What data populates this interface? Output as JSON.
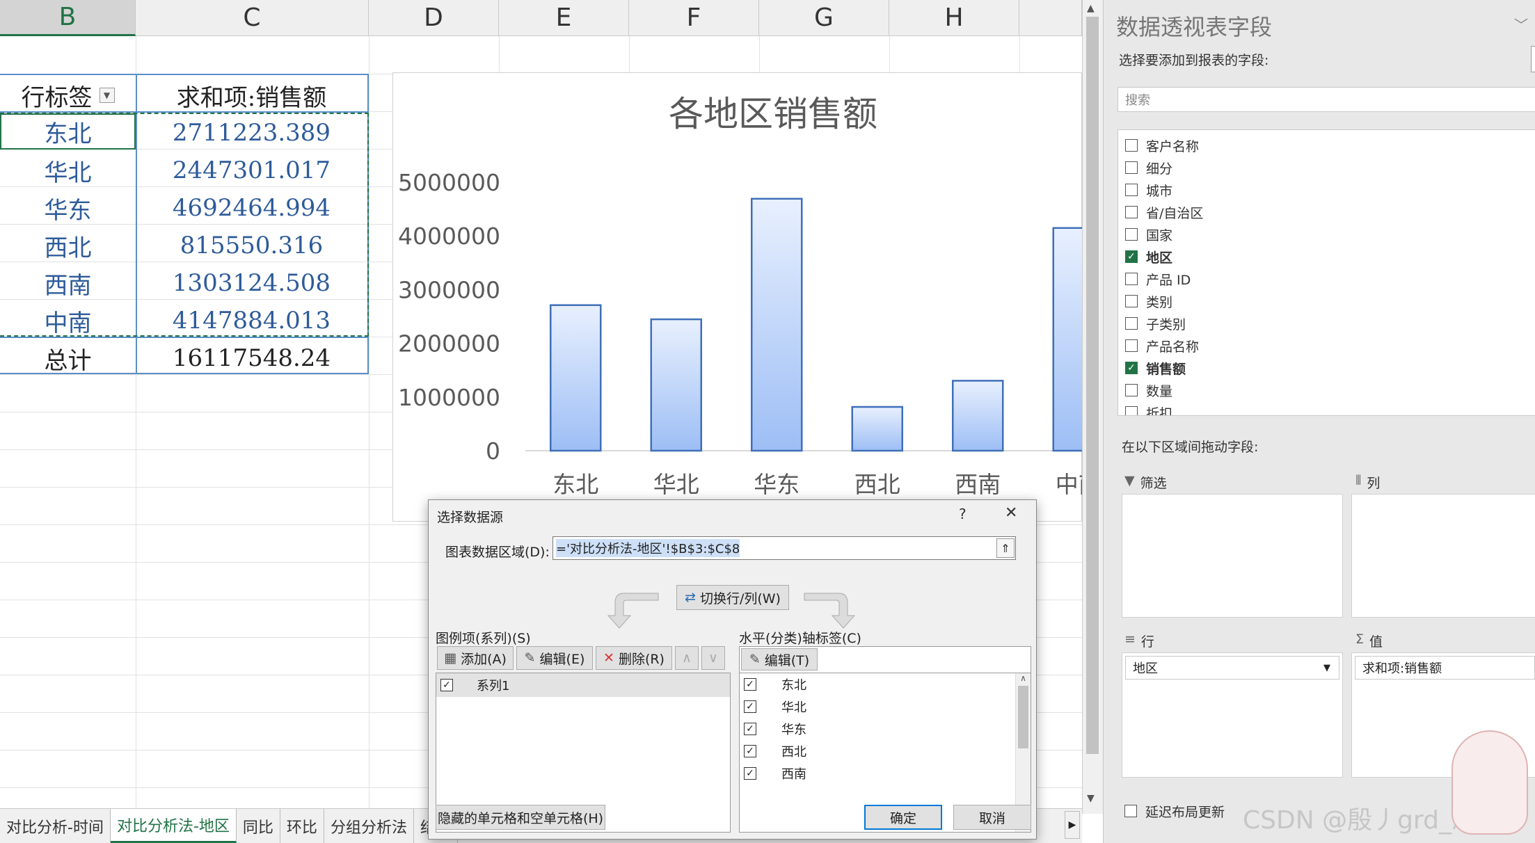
{
  "sheet": {
    "columns": [
      "B",
      "C",
      "D",
      "E",
      "F",
      "G",
      "H"
    ],
    "pivot": {
      "header_row_label": "行标签",
      "header_value_label": "求和项:销售额",
      "rows": [
        {
          "region": "东北",
          "value": "2711223.389"
        },
        {
          "region": "华北",
          "value": "2447301.017"
        },
        {
          "region": "华东",
          "value": "4692464.994"
        },
        {
          "region": "西北",
          "value": "815550.316"
        },
        {
          "region": "西南",
          "value": "1303124.508"
        },
        {
          "region": "中南",
          "value": "4147884.013"
        }
      ],
      "total_label": "总计",
      "total_value": "16117548.24"
    },
    "tabs": [
      "对比分析-时间",
      "对比分析法-地区",
      "同比",
      "环比",
      "分组分析法",
      "结构"
    ],
    "active_tab": "对比分析法-地区"
  },
  "chart_data": {
    "type": "bar",
    "title": "各地区销售额",
    "categories": [
      "东北",
      "华北",
      "华东",
      "西北",
      "西南",
      "中南"
    ],
    "visible_category_labels": [
      "东北",
      "华北",
      "华东",
      "西北",
      "西南",
      "中南"
    ],
    "values": [
      2711223.389,
      2447301.017,
      4692464.994,
      815550.316,
      1303124.508,
      4147884.013
    ],
    "ylim": [
      0,
      5000000
    ],
    "yticks": [
      "0",
      "1000000",
      "2000000",
      "3000000",
      "4000000",
      "5000000"
    ],
    "xlabel": "",
    "ylabel": "",
    "bar_fill_top": "#e8f0fe",
    "bar_fill_bottom": "#9dbef5",
    "bar_stroke": "#3f6fb8",
    "grid": false
  },
  "pane": {
    "title": "数据透视表字段",
    "choose_label": "选择要添加到报表的字段:",
    "search_placeholder": "搜索",
    "fields": [
      {
        "name": "客户名称",
        "checked": false
      },
      {
        "name": "细分",
        "checked": false
      },
      {
        "name": "城市",
        "checked": false
      },
      {
        "name": "省/自治区",
        "checked": false
      },
      {
        "name": "国家",
        "checked": false
      },
      {
        "name": "地区",
        "checked": true
      },
      {
        "name": "产品 ID",
        "checked": false
      },
      {
        "name": "类别",
        "checked": false
      },
      {
        "name": "子类别",
        "checked": false
      },
      {
        "name": "产品名称",
        "checked": false
      },
      {
        "name": "销售额",
        "checked": true
      },
      {
        "name": "数量",
        "checked": false
      },
      {
        "name": "折扣",
        "checked": false
      }
    ],
    "drag_label": "在以下区域间拖动字段:",
    "filter_label": "筛选",
    "columns_label": "列",
    "rows_label": "行",
    "values_label": "值",
    "rows_item": "地区",
    "values_item": "求和项:销售额",
    "defer_label": "延迟布局更新",
    "watermark": "CSDN @殷丿grd_志鹏"
  },
  "dialog": {
    "title": "选择数据源",
    "help": "?",
    "close": "✕",
    "range_label": "图表数据区域(D):",
    "range_value": "='对比分析法-地区'!$B$3:$C$8",
    "switch_label": "切换行/列(W)",
    "legend_label": "图例项(系列)(S)",
    "add_label": "添加(A)",
    "edit_label": "编辑(E)",
    "delete_label": "删除(R)",
    "series": [
      "系列1"
    ],
    "axis_label": "水平(分类)轴标签(C)",
    "axis_edit_label": "编辑(T)",
    "axis_items": [
      "东北",
      "华北",
      "华东",
      "西北",
      "西南"
    ],
    "hidden_cells_label": "隐藏的单元格和空单元格(H)",
    "ok_label": "确定",
    "cancel_label": "取消"
  }
}
